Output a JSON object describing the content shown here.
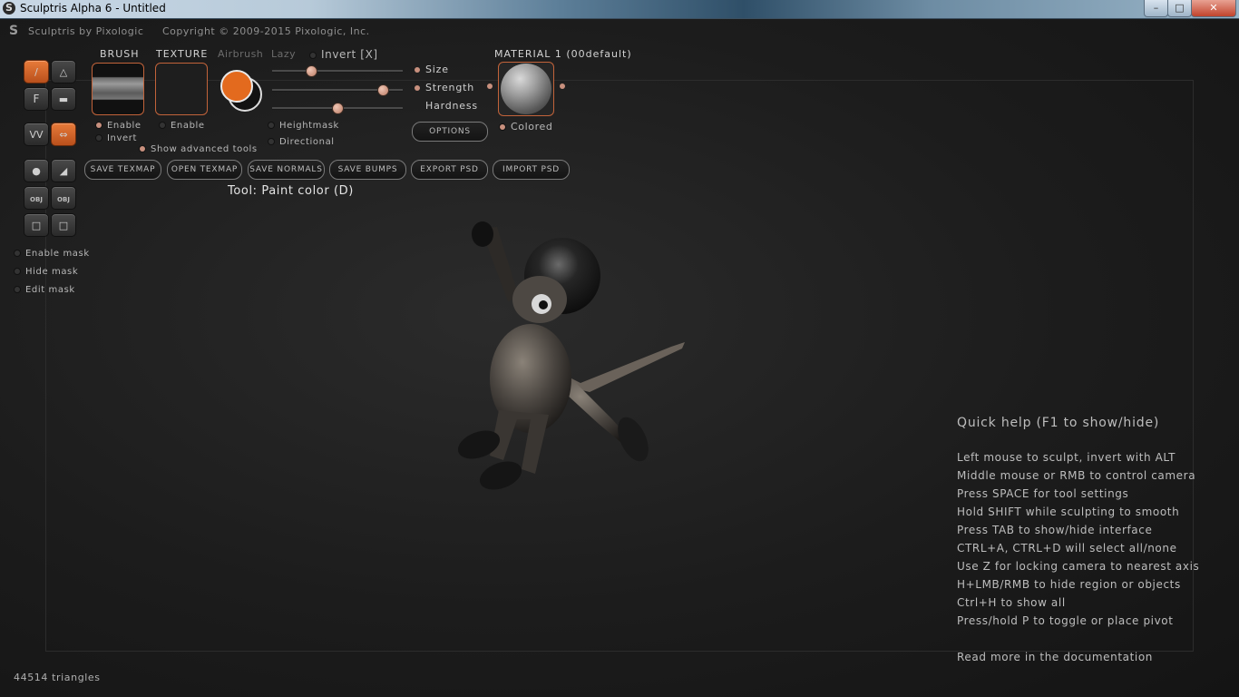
{
  "window": {
    "title": "Sculptris Alpha 6 - Untitled",
    "minimize": "–",
    "maximize": "□",
    "close": "✕"
  },
  "header": {
    "brand": "Sculptris by Pixologic",
    "copyright": "Copyright © 2009-2015 Pixologic, Inc."
  },
  "brush": {
    "label": "BRUSH",
    "enable": "Enable",
    "invert": "Invert"
  },
  "texture": {
    "label": "TEXTURE",
    "enable": "Enable"
  },
  "modes": {
    "airbrush": "Airbrush",
    "lazy": "Lazy",
    "invert": "Invert [X]",
    "heightmask": "Heightmask",
    "directional": "Directional",
    "show_advanced": "Show advanced tools"
  },
  "sliders": {
    "size": {
      "label": "Size",
      "value": 0.3
    },
    "strength": {
      "label": "Strength",
      "value": 0.85
    },
    "hardness": {
      "label": "Hardness",
      "value": 0.5
    }
  },
  "colors": {
    "primary": "#e36a1e",
    "secondary": "#121212"
  },
  "material": {
    "label": "MATERIAL 1 (00default)",
    "colored": "Colored",
    "options": "OPTIONS"
  },
  "actions": {
    "save_texmap": "SAVE TEXMAP",
    "open_texmap": "OPEN TEXMAP",
    "save_normals": "SAVE NORMALS",
    "save_bumps": "SAVE BUMPS",
    "export_psd": "EXPORT PSD",
    "import_psd": "IMPORT PSD"
  },
  "tool_status": "Tool: Paint color (D)",
  "left_tools": {
    "paint_icon": "paint-brush-icon",
    "bump_icon": "bump-icon",
    "fill_label": "F",
    "flatten_icon": "flatten-icon",
    "symmetry_label": "VV",
    "mirror_label": "⇔"
  },
  "mask": {
    "enable": "Enable mask",
    "hide": "Hide mask",
    "edit": "Edit mask"
  },
  "quick_help": {
    "title": "Quick help (F1 to show/hide)",
    "lines": [
      "Left mouse to sculpt, invert with ALT",
      "Middle mouse or RMB to control camera",
      "Press SPACE for tool settings",
      "Hold SHIFT while sculpting to smooth",
      "Press TAB to show/hide interface",
      "CTRL+A, CTRL+D will select all/none",
      "Use Z for locking camera to nearest axis",
      "H+LMB/RMB to hide region or objects",
      "Ctrl+H to show all",
      "Press/hold P to toggle or place pivot"
    ],
    "docs_link": "Read more in the documentation"
  },
  "status": {
    "triangles": "44514 triangles"
  }
}
